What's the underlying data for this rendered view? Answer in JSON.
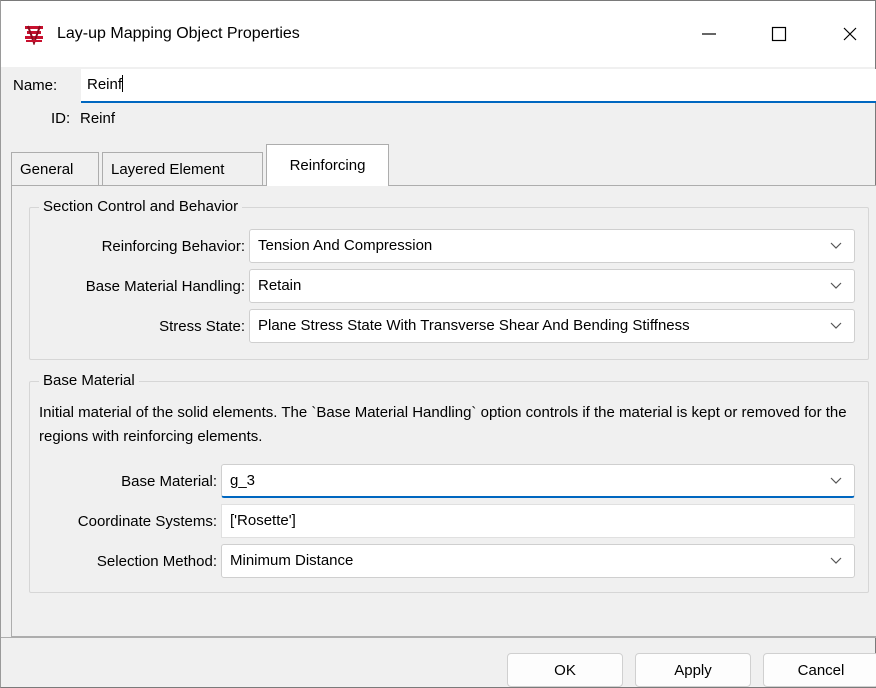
{
  "window": {
    "title": "Lay-up Mapping Object Properties",
    "icon": "app-layup-icon"
  },
  "name_row": {
    "label": "Name:",
    "value": "Reinf"
  },
  "id_row": {
    "label": "ID:",
    "value": "Reinf"
  },
  "tabs": [
    {
      "label": "General",
      "active": false
    },
    {
      "label": "Layered Element",
      "active": false
    },
    {
      "label": "Reinforcing",
      "active": true
    }
  ],
  "section_control": {
    "title": "Section Control and Behavior",
    "fields": [
      {
        "label": "Reinforcing Behavior:",
        "value": "Tension And Compression"
      },
      {
        "label": "Base Material Handling:",
        "value": "Retain"
      },
      {
        "label": "Stress State:",
        "value": "Plane Stress State With Transverse Shear And Bending Stiffness"
      }
    ]
  },
  "base_material": {
    "title": "Base Material",
    "description": "Initial material of the solid elements. The `Base Material Handling` option controls if the material is kept or removed for the regions with reinforcing elements.",
    "fields": [
      {
        "label": "Base Material:",
        "value": "g_3"
      },
      {
        "label": "Coordinate Systems:",
        "value": "['Rosette']"
      },
      {
        "label": "Selection Method:",
        "value": "Minimum Distance"
      }
    ]
  },
  "buttons": {
    "ok": "OK",
    "apply": "Apply",
    "cancel": "Cancel"
  },
  "colors": {
    "accent": "#0067c0",
    "background": "#f0f0f0",
    "icon_red": "#c8102e"
  }
}
